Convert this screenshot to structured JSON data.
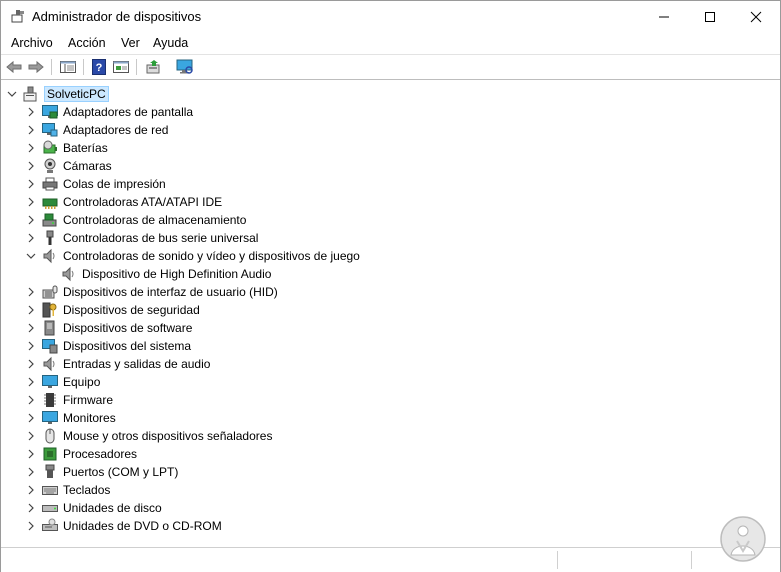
{
  "window": {
    "title": "Administrador de dispositivos"
  },
  "menu": [
    "Archivo",
    "Acción",
    "Ver",
    "Ayuda"
  ],
  "tree": {
    "root": "SolveticPC",
    "items": [
      {
        "label": "Adaptadores de pantalla",
        "icon": "display-adapter-icon",
        "expanded": false
      },
      {
        "label": "Adaptadores de red",
        "icon": "network-adapter-icon",
        "expanded": false
      },
      {
        "label": "Baterías",
        "icon": "battery-icon",
        "expanded": false
      },
      {
        "label": "Cámaras",
        "icon": "camera-icon",
        "expanded": false
      },
      {
        "label": "Colas de impresión",
        "icon": "printer-icon",
        "expanded": false
      },
      {
        "label": "Controladoras ATA/ATAPI IDE",
        "icon": "ide-controller-icon",
        "expanded": false
      },
      {
        "label": "Controladoras de almacenamiento",
        "icon": "storage-controller-icon",
        "expanded": false
      },
      {
        "label": "Controladoras de bus serie universal",
        "icon": "usb-icon",
        "expanded": false
      },
      {
        "label": "Controladoras de sonido y vídeo y dispositivos de juego",
        "icon": "speaker-icon",
        "expanded": true,
        "children": [
          {
            "label": "Dispositivo de High Definition Audio",
            "icon": "speaker-icon"
          }
        ]
      },
      {
        "label": "Dispositivos de interfaz de usuario (HID)",
        "icon": "hid-icon",
        "expanded": false
      },
      {
        "label": "Dispositivos de seguridad",
        "icon": "security-key-icon",
        "expanded": false
      },
      {
        "label": "Dispositivos de software",
        "icon": "software-device-icon",
        "expanded": false
      },
      {
        "label": "Dispositivos del sistema",
        "icon": "system-device-icon",
        "expanded": false
      },
      {
        "label": "Entradas y salidas de audio",
        "icon": "speaker-icon",
        "expanded": false
      },
      {
        "label": "Equipo",
        "icon": "computer-icon",
        "expanded": false
      },
      {
        "label": "Firmware",
        "icon": "firmware-icon",
        "expanded": false
      },
      {
        "label": "Monitores",
        "icon": "monitor-icon",
        "expanded": false
      },
      {
        "label": "Mouse y otros dispositivos señaladores",
        "icon": "mouse-icon",
        "expanded": false
      },
      {
        "label": "Procesadores",
        "icon": "processor-icon",
        "expanded": false
      },
      {
        "label": "Puertos (COM y LPT)",
        "icon": "port-icon",
        "expanded": false
      },
      {
        "label": "Teclados",
        "icon": "keyboard-icon",
        "expanded": false
      },
      {
        "label": "Unidades de disco",
        "icon": "disk-drive-icon",
        "expanded": false
      },
      {
        "label": "Unidades de DVD o CD-ROM",
        "icon": "dvd-drive-icon",
        "expanded": false
      }
    ]
  }
}
